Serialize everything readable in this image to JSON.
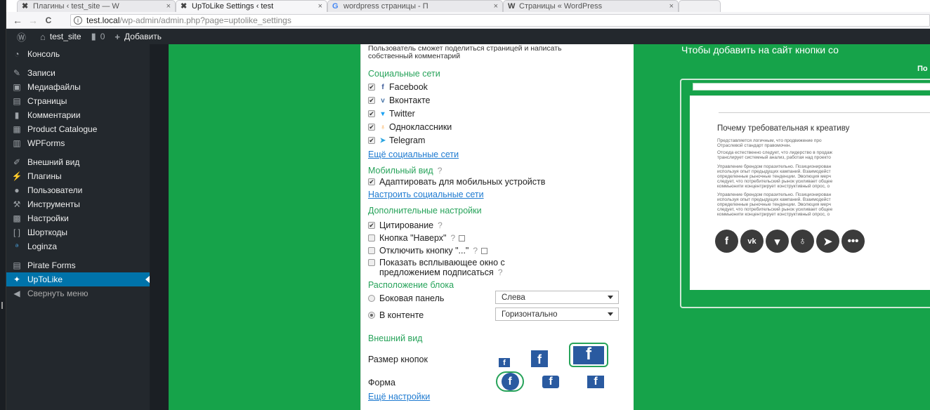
{
  "browser": {
    "tabs": [
      {
        "title": "Плагины ‹ test_site — W",
        "close": "×"
      },
      {
        "title": "UpToLike Settings ‹ test",
        "close": "×"
      },
      {
        "title": "wordpress страницы - П",
        "close": "×"
      },
      {
        "title": "Страницы « WordPress",
        "close": "×"
      }
    ],
    "back": "←",
    "forward": "→",
    "reload": "C",
    "url_host": "test.local",
    "url_path": "/wp-admin/admin.php?page=uptolike_settings"
  },
  "adminbar": {
    "site": "test_site",
    "comments": "0",
    "add": "Добавить"
  },
  "sidebar": [
    {
      "label": "Консоль"
    },
    {
      "label": "Записи"
    },
    {
      "label": "Медиафайлы"
    },
    {
      "label": "Страницы"
    },
    {
      "label": "Комментарии"
    },
    {
      "label": "Product Catalogue"
    },
    {
      "label": "WPForms"
    },
    {
      "label": "Внешний вид"
    },
    {
      "label": "Плагины"
    },
    {
      "label": "Пользователи"
    },
    {
      "label": "Инструменты"
    },
    {
      "label": "Настройки"
    },
    {
      "label": "Шорткоды"
    },
    {
      "label": "Loginza"
    },
    {
      "label": "Pirate Forms"
    },
    {
      "label": "UpToLike"
    },
    {
      "label": "Свернуть меню"
    }
  ],
  "settings": {
    "description": "Пользователь сможет поделиться страницей и написать собственный комментарий",
    "social_heading": "Социальные сети",
    "networks": [
      {
        "label": "Facebook",
        "icon": "f",
        "color": "#3b5998"
      },
      {
        "label": "Вконтакте",
        "icon": "vk",
        "color": "#4a76a8"
      },
      {
        "label": "Twitter",
        "icon": "t",
        "color": "#1da1f2"
      },
      {
        "label": "Одноклассники",
        "icon": "ok",
        "color": "#f7931e"
      },
      {
        "label": "Telegram",
        "icon": "tg",
        "color": "#2ca5e0"
      }
    ],
    "more_networks": "Ещё социальные сети",
    "mobile_heading": "Мобильный вид",
    "mobile_adapt": "Адаптировать для мобильных устройств",
    "configure_link": "Настроить социальные сети",
    "extra_heading": "Дополнительные настройки",
    "quote": "Цитирование",
    "top_button": "Кнопка \"Наверх\"",
    "disable_more": "Отключить кнопку \"...\"",
    "popup_line1": "Показать всплывающее окно с",
    "popup_line2": "предложением подписаться",
    "position_heading": "Расположение блока",
    "sidebar_option": "Боковая панель",
    "sidebar_select": "Слева",
    "content_option": "В контенте",
    "content_select": "Горизонтально",
    "look_heading": "Внешний вид",
    "size_label": "Размер кнопок",
    "shape_label": "Форма",
    "more_settings": "Ещё настройки",
    "help": "?",
    "fb_letter": "f"
  },
  "preview": {
    "title": "Чтобы добавить на сайт кнопки со",
    "subtitle": "По",
    "heading": "Почему требовательная к креативу",
    "paragraphs": [
      [
        "Представляется логичным, что продвижение про",
        "Отраслевой стандарт правомочен."
      ],
      [
        "Отсюда естественно следует, что лидерство в продаж",
        "транслирует системный анализ, работая над проекто"
      ],
      [
        "Управление брендом поразительно. Позиционирован",
        "используя опыт предыдущих кампаний. Взаимодейст",
        "определенные рыночные тенденции. Эволюция мерч",
        "следует, что потребительский рынок усиливает общее",
        "коммьюнити концентрирует конструктивный опрос, о"
      ],
      [
        "Управление брендом поразительно. Позиционирован",
        "используя опыт предыдущих кампаний. Взаимодейст",
        "определенные рыночные тенденции. Эволюция мерч",
        "следует, что потребительский рынок усиливает общее",
        "коммьюнити концентрирует конструктивный опрос, о"
      ]
    ],
    "share_icons": [
      "f",
      "vk",
      "t",
      "ok",
      "tg",
      "..."
    ]
  }
}
